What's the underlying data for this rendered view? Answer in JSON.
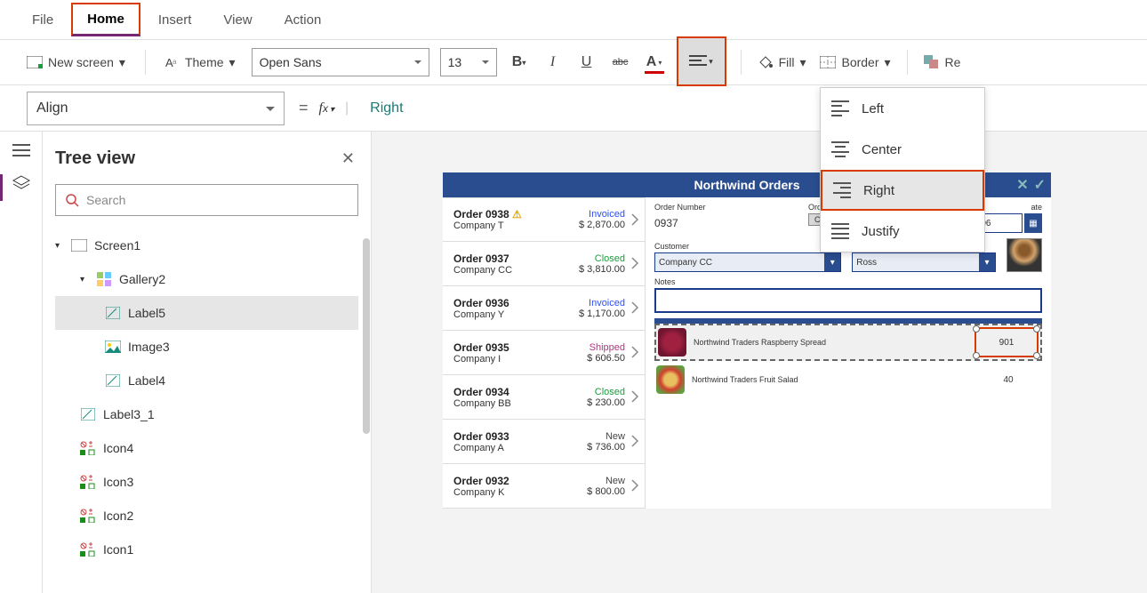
{
  "menu": {
    "file": "File",
    "home": "Home",
    "insert": "Insert",
    "view": "View",
    "action": "Action"
  },
  "ribbon": {
    "new_screen": "New screen",
    "theme": "Theme",
    "font_family": "Open Sans",
    "font_size": "13",
    "fill": "Fill",
    "border": "Border",
    "reorder_prefix": "Re"
  },
  "formula": {
    "property": "Align",
    "value": "Right"
  },
  "tree": {
    "title": "Tree view",
    "search_placeholder": "Search",
    "nodes": {
      "screen1": "Screen1",
      "gallery2": "Gallery2",
      "label5": "Label5",
      "image3": "Image3",
      "label4": "Label4",
      "label3_1": "Label3_1",
      "icon4": "Icon4",
      "icon3": "Icon3",
      "icon2": "Icon2",
      "icon1": "Icon1"
    }
  },
  "app": {
    "title": "Northwind Orders",
    "orders": [
      {
        "id": "Order 0938",
        "company": "Company T",
        "status": "Invoiced",
        "status_cls": "invoiced",
        "price": "$ 2,870.00",
        "warn": true
      },
      {
        "id": "Order 0937",
        "company": "Company CC",
        "status": "Closed",
        "status_cls": "closed",
        "price": "$ 3,810.00"
      },
      {
        "id": "Order 0936",
        "company": "Company Y",
        "status": "Invoiced",
        "status_cls": "invoiced",
        "price": "$ 1,170.00"
      },
      {
        "id": "Order 0935",
        "company": "Company I",
        "status": "Shipped",
        "status_cls": "shipped",
        "price": "$ 606.50"
      },
      {
        "id": "Order 0934",
        "company": "Company BB",
        "status": "Closed",
        "status_cls": "closed",
        "price": "$ 230.00"
      },
      {
        "id": "Order 0933",
        "company": "Company A",
        "status": "New",
        "status_cls": "new",
        "price": "$ 736.00"
      },
      {
        "id": "Order 0932",
        "company": "Company K",
        "status": "New",
        "status_cls": "new",
        "price": "$ 800.00"
      }
    ],
    "detail": {
      "labels": {
        "order_number": "Order Number",
        "order_status": "Order Status",
        "date_suffix": "ate",
        "customer": "Customer",
        "employee": "Employee",
        "notes": "Notes"
      },
      "order_number": "0937",
      "order_status": "Closed",
      "date": ".006",
      "customer": "Company CC",
      "employee": "Ross"
    },
    "items": [
      {
        "name": "Northwind Traders Raspberry Spread",
        "qty": "901"
      },
      {
        "name": "Northwind Traders Fruit Salad",
        "qty": "40"
      }
    ]
  },
  "align_options": {
    "left": "Left",
    "center": "Center",
    "right": "Right",
    "justify": "Justify"
  }
}
